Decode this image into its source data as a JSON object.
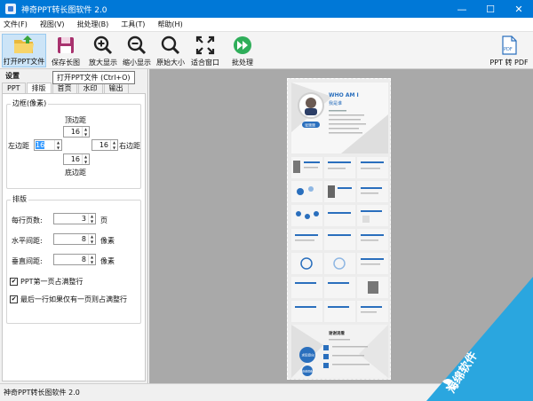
{
  "window": {
    "title": "神奇PPT转长图软件 2.0",
    "controls": {
      "minimize": "—",
      "maximize": "☐",
      "close": "✕"
    }
  },
  "menu": [
    "文件(F)",
    "视图(V)",
    "批处理(B)",
    "工具(T)",
    "帮助(H)"
  ],
  "toolbar": {
    "open": "打开PPT文件",
    "save": "保存长图",
    "zoom_in": "放大显示",
    "zoom_out": "缩小显示",
    "original": "原始大小",
    "fit": "适合窗口",
    "batch": "批处理",
    "ppt2pdf": "PPT 转 PDF",
    "ppt2pdf_badge": "PDF"
  },
  "tooltip": "打开PPT文件 (Ctrl+O)",
  "settings": {
    "header": "设置",
    "tabs": [
      "PPT",
      "排版",
      "首页",
      "水印",
      "输出"
    ],
    "selected_tab": 1,
    "margin_group": {
      "title": "边框(像素)",
      "top_label": "顶边距",
      "top_value": "16",
      "left_label": "左边距",
      "left_value": "16",
      "right_label": "右边距",
      "right_value": "16",
      "bottom_label": "底边距",
      "bottom_value": "16"
    },
    "layout_group": {
      "title": "排版",
      "per_row_label": "每行页数:",
      "per_row_value": "3",
      "per_row_unit": "页",
      "h_gap_label": "水平间距:",
      "h_gap_value": "8",
      "h_gap_unit": "像素",
      "v_gap_label": "垂直间距:",
      "v_gap_value": "8",
      "v_gap_unit": "像素",
      "check1": "PPT第一页占满整行",
      "check1_checked": true,
      "check2": "最后一行如果仅有一页则占满整行",
      "check2_checked": true
    }
  },
  "preview": {
    "heading": "WHO AM I",
    "subheading": "我是谁",
    "name_badge": "张晓晓",
    "ending_title": "谢谢观看",
    "bubble1": "求职意向",
    "bubble2": "感谢观看"
  },
  "status": {
    "text": "神奇PPT转长图软件 2.0"
  },
  "watermark": {
    "text": "海绵软件",
    "color": "#2aa6df"
  },
  "colors": {
    "titlebar": "#0078d7",
    "accent": "#2a6fbd"
  }
}
